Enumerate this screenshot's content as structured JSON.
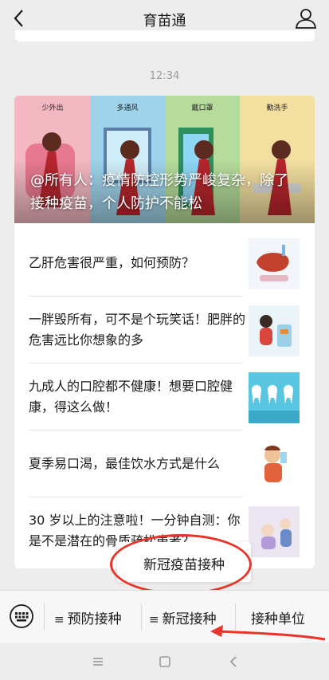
{
  "header": {
    "title": "育苗通",
    "back_icon": "chevron-left-icon",
    "profile_icon": "person-icon"
  },
  "chat": {
    "timestamp": "12:34"
  },
  "article": {
    "banner": {
      "caption": "@所有人：疫情防控形势严峻复杂，除了接种疫苗，个人防护不能松",
      "panels": [
        "少外出",
        "多通风",
        "戴口罩",
        "勤洗手"
      ]
    },
    "items": [
      {
        "title": "乙肝危害很严重，如何预防？"
      },
      {
        "title": "一胖毁所有，可不是个玩笑话！肥胖的危害远比你想象的多"
      },
      {
        "title": "九成人的口腔都不健康！想要口腔健康，得这么做！"
      },
      {
        "title": "夏季易口渴，最佳饮水方式是什么"
      },
      {
        "title": "30 岁以上的注意啦！一分钟自测：你是不是潜在的骨质疏松患者？"
      }
    ]
  },
  "popup": {
    "label": "新冠疫苗接种"
  },
  "menu": {
    "keyboard_icon": "keyboard-icon",
    "items": [
      {
        "label": "预防接种",
        "icon": "≡"
      },
      {
        "label": "新冠接种",
        "icon": "≡"
      },
      {
        "label": "接种单位"
      }
    ]
  },
  "annotation": {
    "ring_color": "#e8352a",
    "arrow_color": "#e8352a"
  }
}
